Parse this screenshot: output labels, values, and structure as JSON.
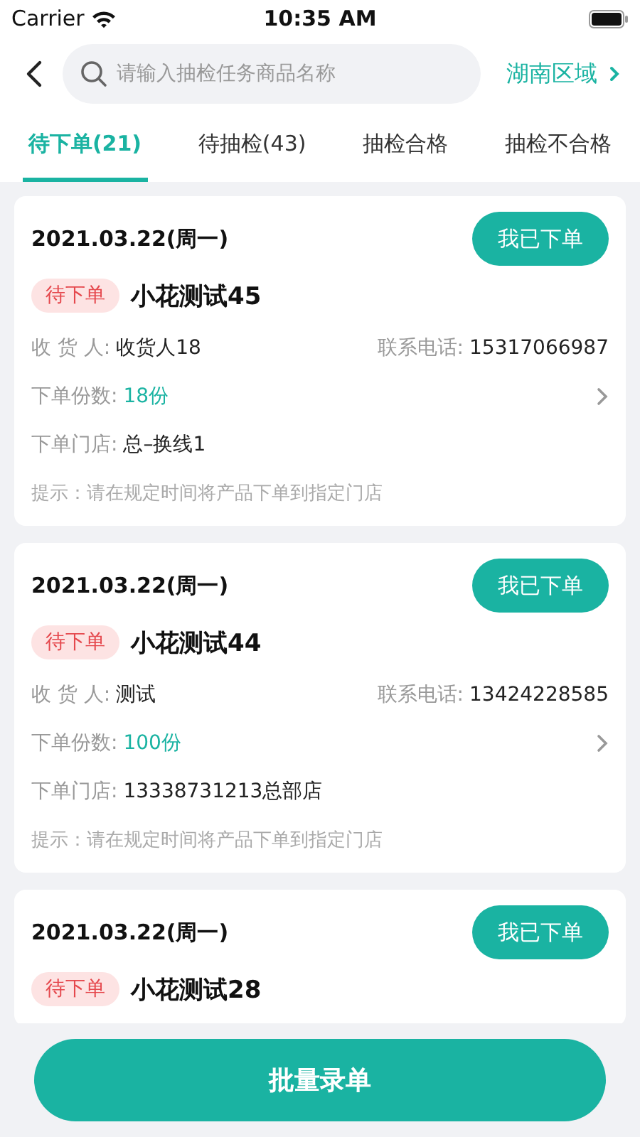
{
  "status_bar": {
    "carrier": "Carrier",
    "time": "10:35 AM"
  },
  "header": {
    "search": {
      "placeholder": "请输入抽检任务商品名称"
    },
    "region": "湖南区域"
  },
  "tabs": [
    {
      "label": "待下单(21)",
      "selected": true
    },
    {
      "label": "待抽检(43)",
      "selected": false
    },
    {
      "label": "抽检合格",
      "selected": false
    },
    {
      "label": "抽检不合格",
      "selected": false
    }
  ],
  "orders": [
    {
      "date": "2021.03.22(周一)",
      "action": "我已下单",
      "status": "待下单",
      "title": "小花测试45",
      "receiver_label": "收 货 人:",
      "receiver": "收货人18",
      "phone_label": "联系电话:",
      "phone": "15317066987",
      "quantity_label": "下单份数:",
      "quantity": "18份",
      "store_label": "下单门店:",
      "store": "总–换线1",
      "hint": "提示：请在规定时间将产品下单到指定门店"
    },
    {
      "date": "2021.03.22(周一)",
      "action": "我已下单",
      "status": "待下单",
      "title": "小花测试44",
      "receiver_label": "收 货 人:",
      "receiver": "测试",
      "phone_label": "联系电话:",
      "phone": "13424228585",
      "quantity_label": "下单份数:",
      "quantity": "100份",
      "store_label": "下单门店:",
      "store": "13338731213总部店",
      "hint": "提示：请在规定时间将产品下单到指定门店"
    },
    {
      "date": "2021.03.22(周一)",
      "action": "我已下单",
      "status": "待下单",
      "title": "小花测试28"
    }
  ],
  "bottom_button": "批量录单"
}
